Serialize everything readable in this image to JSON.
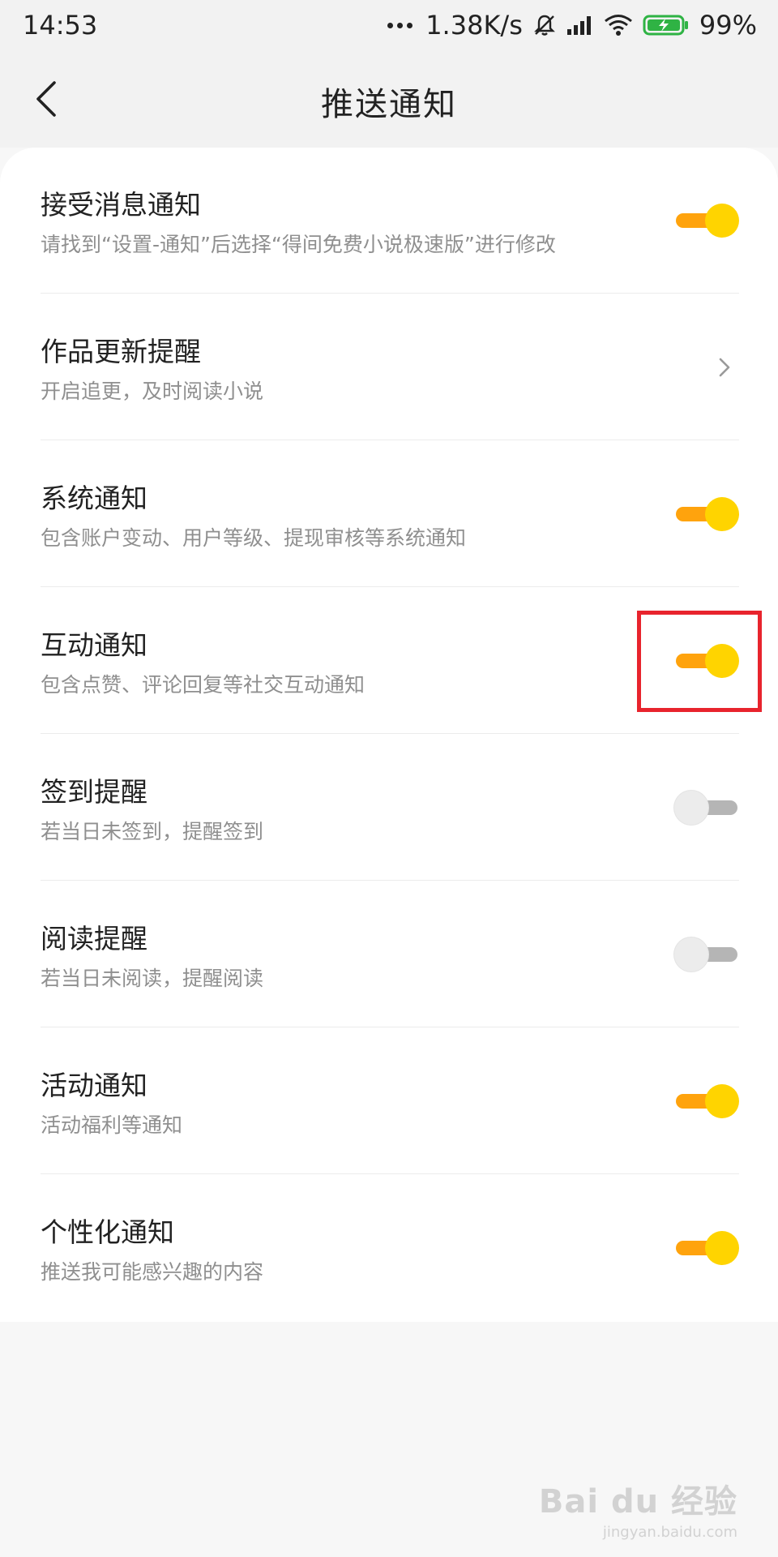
{
  "status_bar": {
    "time": "14:53",
    "network_speed": "1.38K/s",
    "battery": "99%",
    "icons": [
      "more-dots-icon",
      "mute-bell-icon",
      "signal-icon",
      "wifi-icon",
      "battery-charging-icon"
    ]
  },
  "header": {
    "title": "推送通知",
    "back_icon": "chevron-left-icon"
  },
  "settings": [
    {
      "title": "接受消息通知",
      "subtitle": "请找到“设置-通知”后选择“得间免费小说极速版”进行修改",
      "control": "toggle",
      "enabled": true
    },
    {
      "title": "作品更新提醒",
      "subtitle": "开启追更，及时阅读小说",
      "control": "chevron"
    },
    {
      "title": "系统通知",
      "subtitle": "包含账户变动、用户等级、提现审核等系统通知",
      "control": "toggle",
      "enabled": true
    },
    {
      "title": "互动通知",
      "subtitle": "包含点赞、评论回复等社交互动通知",
      "control": "toggle",
      "enabled": true,
      "highlighted": true
    },
    {
      "title": "签到提醒",
      "subtitle": "若当日未签到，提醒签到",
      "control": "toggle",
      "enabled": false
    },
    {
      "title": "阅读提醒",
      "subtitle": "若当日未阅读，提醒阅读",
      "control": "toggle",
      "enabled": false
    },
    {
      "title": "活动通知",
      "subtitle": "活动福利等通知",
      "control": "toggle",
      "enabled": true
    },
    {
      "title": "个性化通知",
      "subtitle": "推送我可能感兴趣的内容",
      "control": "toggle",
      "enabled": true
    }
  ],
  "colors": {
    "toggle_on_track": "#ffa30d",
    "toggle_on_knob": "#ffd400",
    "toggle_off_track": "#b5b5b5",
    "toggle_off_knob": "#ececec",
    "highlight": "#e8242d"
  },
  "watermark": {
    "main": "Bai du 经验",
    "sub": "jingyan.baidu.com"
  }
}
